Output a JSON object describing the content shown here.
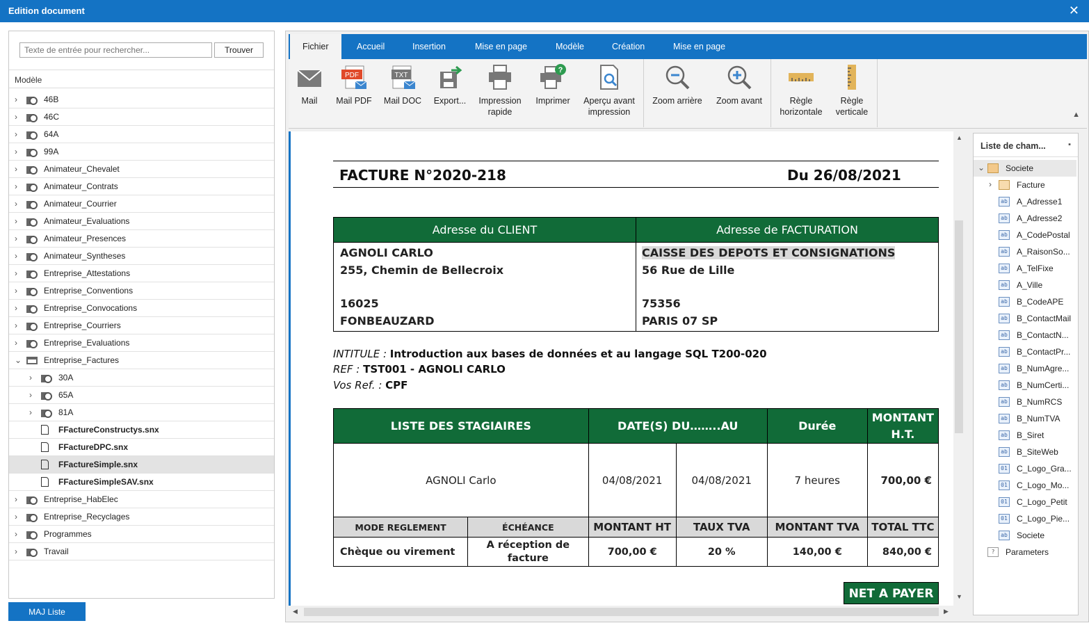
{
  "window": {
    "title": "Edition document",
    "close": "✕"
  },
  "search": {
    "placeholder": "Texte de entrée pour rechercher...",
    "button": "Trouver"
  },
  "tree": {
    "header": "Modèle",
    "items": [
      {
        "label": "46B"
      },
      {
        "label": "46C"
      },
      {
        "label": "64A"
      },
      {
        "label": "99A"
      },
      {
        "label": "Animateur_Chevalet"
      },
      {
        "label": "Animateur_Contrats"
      },
      {
        "label": "Animateur_Courrier"
      },
      {
        "label": "Animateur_Evaluations"
      },
      {
        "label": "Animateur_Presences"
      },
      {
        "label": "Animateur_Syntheses"
      },
      {
        "label": "Entreprise_Attestations"
      },
      {
        "label": "Entreprise_Conventions"
      },
      {
        "label": "Entreprise_Convocations"
      },
      {
        "label": "Entreprise_Courriers"
      },
      {
        "label": "Entreprise_Evaluations"
      },
      {
        "label": "Entreprise_Factures"
      },
      {
        "label": "30A"
      },
      {
        "label": "65A"
      },
      {
        "label": "81A"
      },
      {
        "label": "FFactureConstructys.snx"
      },
      {
        "label": "FFactureDPC.snx"
      },
      {
        "label": "FFactureSimple.snx"
      },
      {
        "label": "FFactureSimpleSAV.snx"
      },
      {
        "label": "Entreprise_HabElec"
      },
      {
        "label": "Entreprise_Recyclages"
      },
      {
        "label": "Programmes"
      },
      {
        "label": "Travail"
      }
    ]
  },
  "maj_button": "MAJ Liste",
  "tabs": [
    "Fichier",
    "Accueil",
    "Insertion",
    "Mise en page",
    "Modèle",
    "Création",
    "Mise en page"
  ],
  "ribbon": {
    "mail": "Mail",
    "mail_pdf": "Mail PDF",
    "mail_doc": "Mail DOC",
    "export": "Export...",
    "impression_rapide_1": "Impression",
    "impression_rapide_2": "rapide",
    "imprimer": "Imprimer",
    "apercu_1": "Aperçu avant",
    "apercu_2": "impression",
    "zoom_arriere": "Zoom arrière",
    "zoom_avant": "Zoom avant",
    "regle_h_1": "Règle",
    "regle_h_2": "horizontale",
    "regle_v_1": "Règle",
    "regle_v_2": "verticale",
    "pdf_tag": "PDF",
    "txt_tag": "TXT"
  },
  "invoice": {
    "title": "FACTURE N°2020-218",
    "date": "Du 26/08/2021",
    "client_hdr": "Adresse du CLIENT",
    "billing_hdr": "Adresse de FACTURATION",
    "client": {
      "name": "AGNOLI CARLO",
      "street": "255, Chemin de Bellecroix",
      "zip": "16025",
      "city": "FONBEAUZARD"
    },
    "billing": {
      "name": "CAISSE DES DEPOTS ET CONSIGNATIONS",
      "street": "56 Rue de Lille",
      "zip": "75356",
      "city": "PARIS 07 SP"
    },
    "intitule_label": "INTITULE : ",
    "intitule": "Introduction aux bases de données et au langage SQL T200-020",
    "ref_label": "REF : ",
    "ref": "TST001 - AGNOLI CARLO",
    "vosref_label": "Vos Ref. : ",
    "vosref": "CPF",
    "col_stagiaires": "LISTE DES STAGIAIRES",
    "col_dates": "DATE(S) DU……..AU",
    "col_duree": "Durée",
    "col_montant_1": "MONTANT",
    "col_montant_2": "H.T.",
    "row": {
      "name": "AGNOLI Carlo",
      "du": "04/08/2021",
      "au": "04/08/2021",
      "duree": "7 heures",
      "montant": "700,00 €"
    },
    "h_mode": "MODE REGLEMENT",
    "h_echeance": "ÉCHÉANCE",
    "h_mht": "MONTANT HT",
    "h_taux": "TAUX TVA",
    "h_mtva": "MONTANT TVA",
    "h_ttc": "TOTAL TTC",
    "mode": "Chèque ou virement",
    "echeance_1": "A réception de",
    "echeance_2": "facture",
    "mht": "700,00 €",
    "taux": "20 %",
    "mtva": "140,00 €",
    "ttc": "840,00 €",
    "net": "NET A PAYER"
  },
  "fields": {
    "header": "Liste de cham...",
    "root": "Societe",
    "facture": "Facture",
    "items": [
      "A_Adresse1",
      "A_Adresse2",
      "A_CodePostal",
      "A_RaisonSo...",
      "A_TelFixe",
      "A_Ville",
      "B_CodeAPE",
      "B_ContactMail",
      "B_ContactN...",
      "B_ContactPr...",
      "B_NumAgre...",
      "B_NumCerti...",
      "B_NumRCS",
      "B_NumTVA",
      "B_Siret",
      "B_SiteWeb",
      "C_Logo_Gra...",
      "C_Logo_Mo...",
      "C_Logo_Petit",
      "C_Logo_Pie...",
      "Societe"
    ],
    "parameters": "Parameters",
    "ab": "ab",
    "num": "01",
    "q": "?"
  }
}
